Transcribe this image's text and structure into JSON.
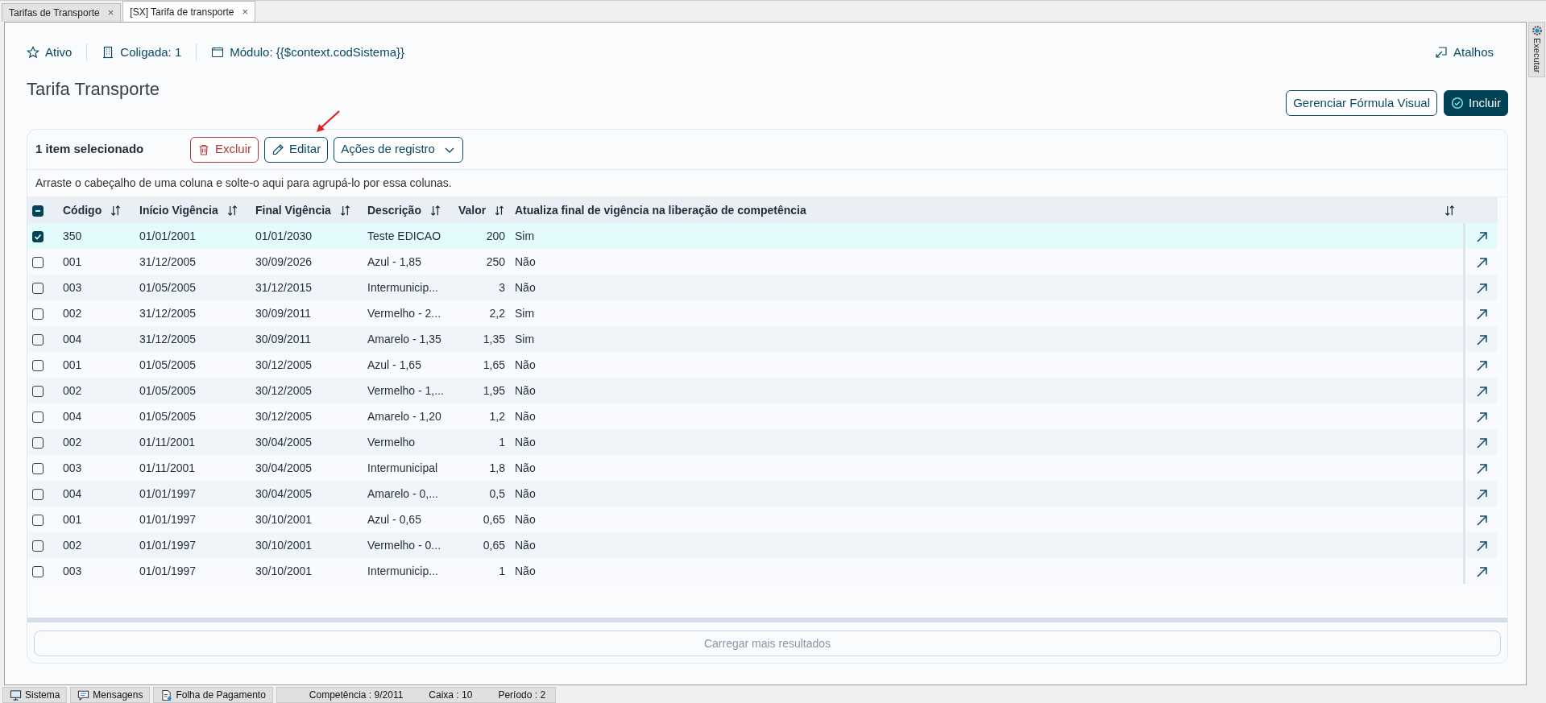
{
  "tabs": [
    {
      "label": "Tarifas de Transporte",
      "selected": false,
      "close": "×"
    },
    {
      "label": "[SX] Tarifa de transporte",
      "selected": true,
      "close": "×"
    }
  ],
  "header_info": [
    {
      "kind": "star",
      "label": "Ativo"
    },
    {
      "kind": "building",
      "label": "Coligada: 1"
    },
    {
      "kind": "window",
      "label": "Módulo: {{$context.codSistema}}"
    }
  ],
  "shortcuts": {
    "label": "Atalhos"
  },
  "side_panel": {
    "label": "Executar"
  },
  "title": "Tarifa Transporte",
  "page_actions": [
    {
      "kind": "outline",
      "label": "Gerenciar Fórmula Visual"
    },
    {
      "kind": "primary",
      "label": "Incluir"
    }
  ],
  "toolbar": {
    "selection": "1 item selecionado",
    "actions": [
      {
        "kind": "delete",
        "label": "Excluir"
      },
      {
        "kind": "edit",
        "label": "Editar"
      },
      {
        "kind": "dropdown",
        "label": "Ações de registro"
      }
    ]
  },
  "group_hint": "Arraste o cabeçalho de uma coluna e solte-o aqui para agrupá-lo por essa colunas.",
  "table": {
    "header_checkbox": {
      "indeterminate": true
    },
    "columns": [
      {
        "label": "Código",
        "kind": "text"
      },
      {
        "label": "Início Vigência",
        "kind": "text"
      },
      {
        "label": "Final Vigência",
        "kind": "text"
      },
      {
        "label": "Descrição",
        "kind": "text"
      },
      {
        "label": "Valor",
        "kind": "number"
      },
      {
        "label": "Atualiza final de vigência na liberação de competência",
        "kind": "text"
      }
    ],
    "rows": [
      {
        "selected": true,
        "cells": [
          "350",
          "01/01/2001",
          "01/01/2030",
          "Teste EDICAO",
          "200",
          "Sim"
        ]
      },
      {
        "selected": false,
        "cells": [
          "001",
          "31/12/2005",
          "30/09/2026",
          "Azul - 1,85",
          "250",
          "Não"
        ]
      },
      {
        "selected": false,
        "cells": [
          "003",
          "01/05/2005",
          "31/12/2015",
          "Intermunicip...",
          "3",
          "Não"
        ]
      },
      {
        "selected": false,
        "cells": [
          "002",
          "31/12/2005",
          "30/09/2011",
          "Vermelho - 2...",
          "2,2",
          "Sim"
        ]
      },
      {
        "selected": false,
        "cells": [
          "004",
          "31/12/2005",
          "30/09/2011",
          "Amarelo - 1,35",
          "1,35",
          "Sim"
        ]
      },
      {
        "selected": false,
        "cells": [
          "001",
          "01/05/2005",
          "30/12/2005",
          "Azul - 1,65",
          "1,65",
          "Não"
        ]
      },
      {
        "selected": false,
        "cells": [
          "002",
          "01/05/2005",
          "30/12/2005",
          "Vermelho - 1,...",
          "1,95",
          "Não"
        ]
      },
      {
        "selected": false,
        "cells": [
          "004",
          "01/05/2005",
          "30/12/2005",
          "Amarelo - 1,20",
          "1,2",
          "Não"
        ]
      },
      {
        "selected": false,
        "cells": [
          "002",
          "01/11/2001",
          "30/04/2005",
          "Vermelho",
          "1",
          "Não"
        ]
      },
      {
        "selected": false,
        "cells": [
          "003",
          "01/11/2001",
          "30/04/2005",
          "Intermunicipal",
          "1,8",
          "Não"
        ]
      },
      {
        "selected": false,
        "cells": [
          "004",
          "01/01/1997",
          "30/04/2005",
          "Amarelo - 0,...",
          "0,5",
          "Não"
        ]
      },
      {
        "selected": false,
        "cells": [
          "001",
          "01/01/1997",
          "30/10/2001",
          "Azul - 0,65",
          "0,65",
          "Não"
        ]
      },
      {
        "selected": false,
        "cells": [
          "002",
          "01/01/1997",
          "30/10/2001",
          "Vermelho - 0...",
          "0,65",
          "Não"
        ]
      },
      {
        "selected": false,
        "cells": [
          "003",
          "01/01/1997",
          "30/10/2001",
          "Intermunicip...",
          "1",
          "Não"
        ]
      }
    ]
  },
  "load_more": {
    "label": "Carregar mais resultados",
    "disabled": true
  },
  "status_bar": {
    "panels": [
      {
        "kind": "monitor",
        "label": "Sistema"
      },
      {
        "kind": "message",
        "label": "Mensagens"
      },
      {
        "kind": "document",
        "label": "Folha de Pagamento"
      }
    ],
    "info": [
      "Competência : 9/2011",
      "Caixa : 10",
      "Período : 2"
    ]
  }
}
